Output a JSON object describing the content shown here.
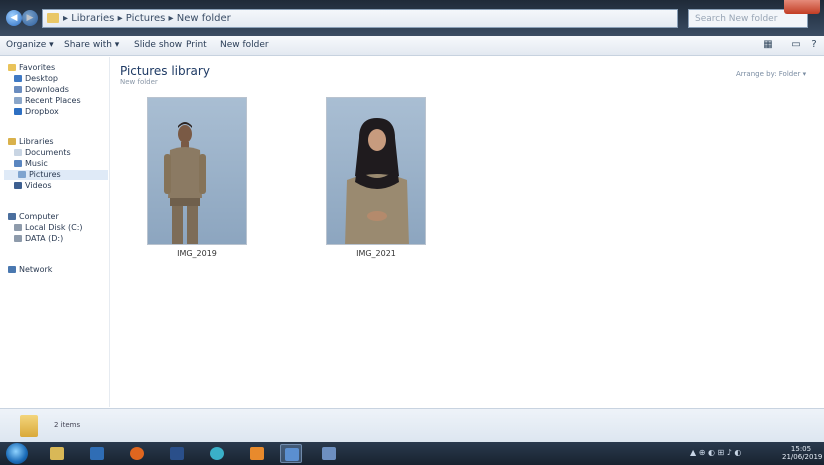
{
  "window": {
    "address_path": "▸ Libraries ▸ Pictures ▸ New folder",
    "search_placeholder": "Search New folder"
  },
  "toolbar": {
    "organize": "Organize ▾",
    "share_with": "Share with ▾",
    "slide_show": "Slide show",
    "print": "Print",
    "new_folder": "New folder",
    "views_icon": "views-icon",
    "preview_icon": "preview-pane-icon",
    "help_icon": "help-icon"
  },
  "nav": {
    "favorites": "Favorites",
    "desktop": "Desktop",
    "downloads": "Downloads",
    "recent_places": "Recent Places",
    "dropbox": "Dropbox",
    "libraries": "Libraries",
    "documents": "Documents",
    "music": "Music",
    "pictures": "Pictures",
    "videos": "Videos",
    "computer": "Computer",
    "local_disk": "Local Disk (C:)",
    "disk_d": "DATA (D:)",
    "network": "Network"
  },
  "content": {
    "library_title": "Pictures library",
    "library_subtitle": "New folder",
    "arrange_by": "Arrange by: Folder ▾",
    "items": [
      {
        "caption": "IMG_2019"
      },
      {
        "caption": "IMG_2021"
      }
    ]
  },
  "details": {
    "text": "2 items"
  },
  "taskbar": {
    "tray_text": "▲ ⊕ ◐ ⊞ ♪ ◐",
    "clock_time": "15:05",
    "clock_date": "21/06/2019"
  },
  "colors": {
    "titlebar": "#2e3e52",
    "accent": "#1e3a64",
    "selection": "#dfeaf7",
    "photo_bg": "#9bb0c7"
  }
}
